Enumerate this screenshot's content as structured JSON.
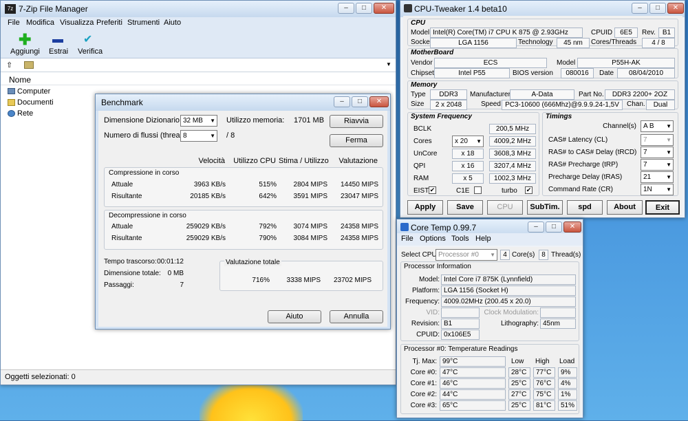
{
  "zip": {
    "title": "7-Zip File Manager",
    "menu": [
      "File",
      "Modifica",
      "Visualizza",
      "Preferiti",
      "Strumenti",
      "Aiuto"
    ],
    "toolbar": [
      "Aggiungi",
      "Estrai",
      "Verifica"
    ],
    "column_name": "Nome",
    "tree": [
      "Computer",
      "Documenti",
      "Rete"
    ],
    "status": "Oggetti selezionati: 0"
  },
  "bench": {
    "title": "Benchmark",
    "dict_label": "Dimensione Dizionario:",
    "dict_value": "32 MB",
    "mem_label": "Utilizzo memoria:",
    "mem_value": "1701 MB",
    "threads_label": "Numero di flussi (thread)",
    "threads_value": "8",
    "threads_of": "/ 8",
    "restart": "Riavvia",
    "stop": "Ferma",
    "cols": [
      "Velocità",
      "Utilizzo CPU",
      "Stima / Utilizzo",
      "Valutazione"
    ],
    "comp_title": "Compressione in corso",
    "comp": [
      [
        "Attuale",
        "3963 KB/s",
        "515%",
        "2804 MIPS",
        "14450 MIPS"
      ],
      [
        "Risultante",
        "20185 KB/s",
        "642%",
        "3591 MIPS",
        "23047 MIPS"
      ]
    ],
    "decomp_title": "Decompressione in corso",
    "decomp": [
      [
        "Attuale",
        "259029 KB/s",
        "792%",
        "3074 MIPS",
        "24358 MIPS"
      ],
      [
        "Risultante",
        "259029 KB/s",
        "790%",
        "3084 MIPS",
        "24358 MIPS"
      ]
    ],
    "elapsed_label": "Tempo trascorso:",
    "elapsed": "00:01:12",
    "size_label": "Dimensione totale:",
    "size": "0 MB",
    "passes_label": "Passaggi:",
    "passes": "7",
    "total_title": "Valutazione totale",
    "total": [
      "716%",
      "3338 MIPS",
      "23702 MIPS"
    ],
    "help": "Aiuto",
    "cancel": "Annulla"
  },
  "tweak": {
    "title": "CPU-Tweaker 1.4 beta10",
    "cpu_hdr": "CPU",
    "model_lbl": "Model",
    "model": "Intel(R) Core(TM) i7 CPU      K 875  @ 2.93GHz",
    "cpuid_lbl": "CPUID",
    "cpuid": "6E5",
    "rev_lbl": "Rev.",
    "rev": "B1",
    "socket_lbl": "Socket",
    "socket": "LGA 1156",
    "tech_lbl": "Technology",
    "tech": "45 nm",
    "ct_lbl": "Cores/Threads",
    "ct": "4 / 8",
    "mb_hdr": "MotherBoard",
    "vendor_lbl": "Vendor",
    "vendor": "ECS",
    "mbmodel_lbl": "Model",
    "mbmodel": "P55H-AK",
    "chipset_lbl": "Chipset",
    "chipset": "Intel P55",
    "bios_lbl": "BIOS version",
    "bios": "080016",
    "date_lbl": "Date",
    "date": "08/04/2010",
    "mem_hdr": "Memory",
    "type_lbl": "Type",
    "type": "DDR3",
    "manu_lbl": "Manufacturer",
    "manu": "A-Data",
    "part_lbl": "Part No.",
    "part": "DDR3 2200+ 2OZ",
    "msize_lbl": "Size",
    "msize": "2 x 2048",
    "speed_lbl": "Speed",
    "speed": "PC3-10600 (666Mhz)@9.9.9.24-1,5V",
    "chan_lbl": "Chan.",
    "chan": "Dual",
    "sf_hdr": "System Frequency",
    "bclk_lbl": "BCLK",
    "bclk": "200,5 MHz",
    "cores_lbl": "Cores",
    "cores_mult": "x 20",
    "cores": "4009,2 MHz",
    "uncore_lbl": "UnCore",
    "uncore_mult": "x 18",
    "uncore": "3608,3 MHz",
    "qpi_lbl": "QPI",
    "qpi_mult": "x 16",
    "qpi": "3207,4 MHz",
    "ram_lbl": "RAM",
    "ram_mult": "x 5",
    "ram": "1002,3 MHz",
    "eist": "EIST",
    "c1e": "C1E",
    "turbo": "turbo",
    "tim_hdr": "Timings",
    "channel_lbl": "Channel(s)",
    "channel": "A  B",
    "cl_lbl": "CAS# Latency (CL)",
    "cl": "7",
    "trcd_lbl": "RAS# to CAS# Delay (tRCD)",
    "trcd": "7",
    "trp_lbl": "RAS# Precharge (tRP)",
    "trp": "7",
    "tras_lbl": "Precharge Delay (tRAS)",
    "tras": "21",
    "cr_lbl": "Command Rate (CR)",
    "cr": "1N",
    "buttons": [
      "Apply",
      "Save",
      "CPU",
      "SubTim.",
      "spd",
      "About",
      "Exit"
    ]
  },
  "ct": {
    "title": "Core Temp 0.99.7",
    "menu": [
      "File",
      "Options",
      "Tools",
      "Help"
    ],
    "selcpu_lbl": "Select CPU:",
    "selcpu": "Processor #0",
    "cores": "4",
    "cores_lbl": "Core(s)",
    "threads": "8",
    "threads_lbl": "Thread(s)",
    "info_hdr": "Processor Information",
    "model_lbl": "Model:",
    "model": "Intel Core i7 875K (Lynnfield)",
    "platform_lbl": "Platform:",
    "platform": "LGA 1156 (Socket H)",
    "freq_lbl": "Frequency:",
    "freq": "4009.02MHz (200.45 x 20.0)",
    "vid_lbl": "VID:",
    "clockmod_lbl": "Clock Modulation:",
    "rev_lbl": "Revision:",
    "rev": "B1",
    "lith_lbl": "Lithography:",
    "lith": "45nm",
    "cpuid_lbl": "CPUID:",
    "cpuid": "0x106E5",
    "temp_hdr": "Processor #0: Temperature Readings",
    "tjmax_lbl": "Tj. Max:",
    "tjmax": "99°C",
    "cols": [
      "Low",
      "High",
      "Load"
    ],
    "cores_rows": [
      [
        "Core #0:",
        "47°C",
        "28°C",
        "77°C",
        "9%"
      ],
      [
        "Core #1:",
        "46°C",
        "25°C",
        "76°C",
        "4%"
      ],
      [
        "Core #2:",
        "44°C",
        "27°C",
        "75°C",
        "1%"
      ],
      [
        "Core #3:",
        "65°C",
        "25°C",
        "81°C",
        "51%"
      ]
    ]
  }
}
